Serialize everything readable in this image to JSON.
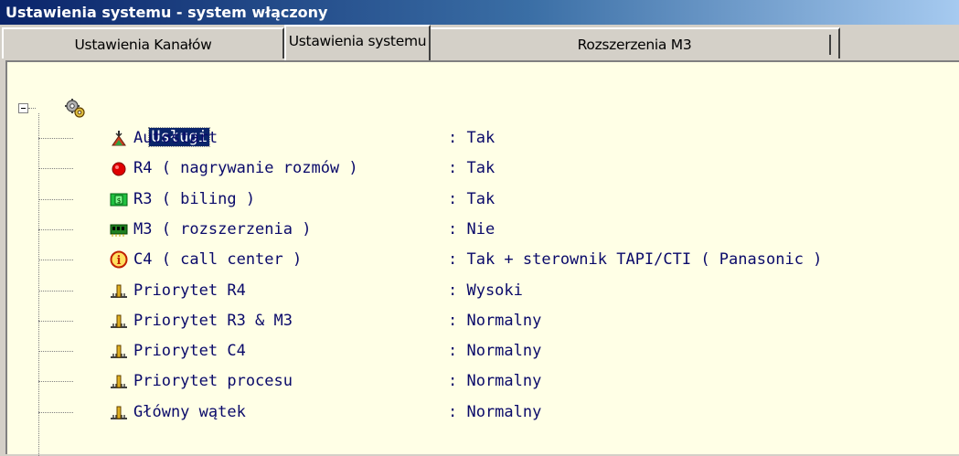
{
  "window": {
    "title": "Ustawienia systemu - system włączony"
  },
  "tabs": [
    {
      "label": "Ustawienia Kanałów"
    },
    {
      "label": "Ustawienia systemu"
    },
    {
      "label": "Rozszerzenia M3"
    }
  ],
  "tree": {
    "root_label": "Usługi",
    "items": [
      {
        "label": "Autostart",
        "value": ": Tak",
        "icon": "autostart-icon"
      },
      {
        "label": "R4 ( nagrywanie rozmów )",
        "value": ": Tak",
        "icon": "record-icon"
      },
      {
        "label": "R3 ( biling )",
        "value": ": Tak",
        "icon": "billing-icon"
      },
      {
        "label": "M3 ( rozszerzenia )",
        "value": ": Nie",
        "icon": "extension-card-icon"
      },
      {
        "label": "C4 ( call center )",
        "value": ": Tak + sterownik TAPI/CTI ( Panasonic )",
        "icon": "info-icon"
      },
      {
        "label": "Priorytet R4",
        "value": ": Wysoki",
        "icon": "priority-icon"
      },
      {
        "label": "Priorytet R3 & M3",
        "value": ": Normalny",
        "icon": "priority-icon"
      },
      {
        "label": "Priorytet C4",
        "value": ": Normalny",
        "icon": "priority-icon"
      },
      {
        "label": "Priorytet procesu",
        "value": ": Normalny",
        "icon": "priority-icon"
      },
      {
        "label": "Główny wątek",
        "value": ": Normalny",
        "icon": "priority-icon"
      }
    ]
  },
  "colors": {
    "selection": "#0a246a",
    "panel_bg": "#ffffe6",
    "text": "#0a0a6a"
  }
}
